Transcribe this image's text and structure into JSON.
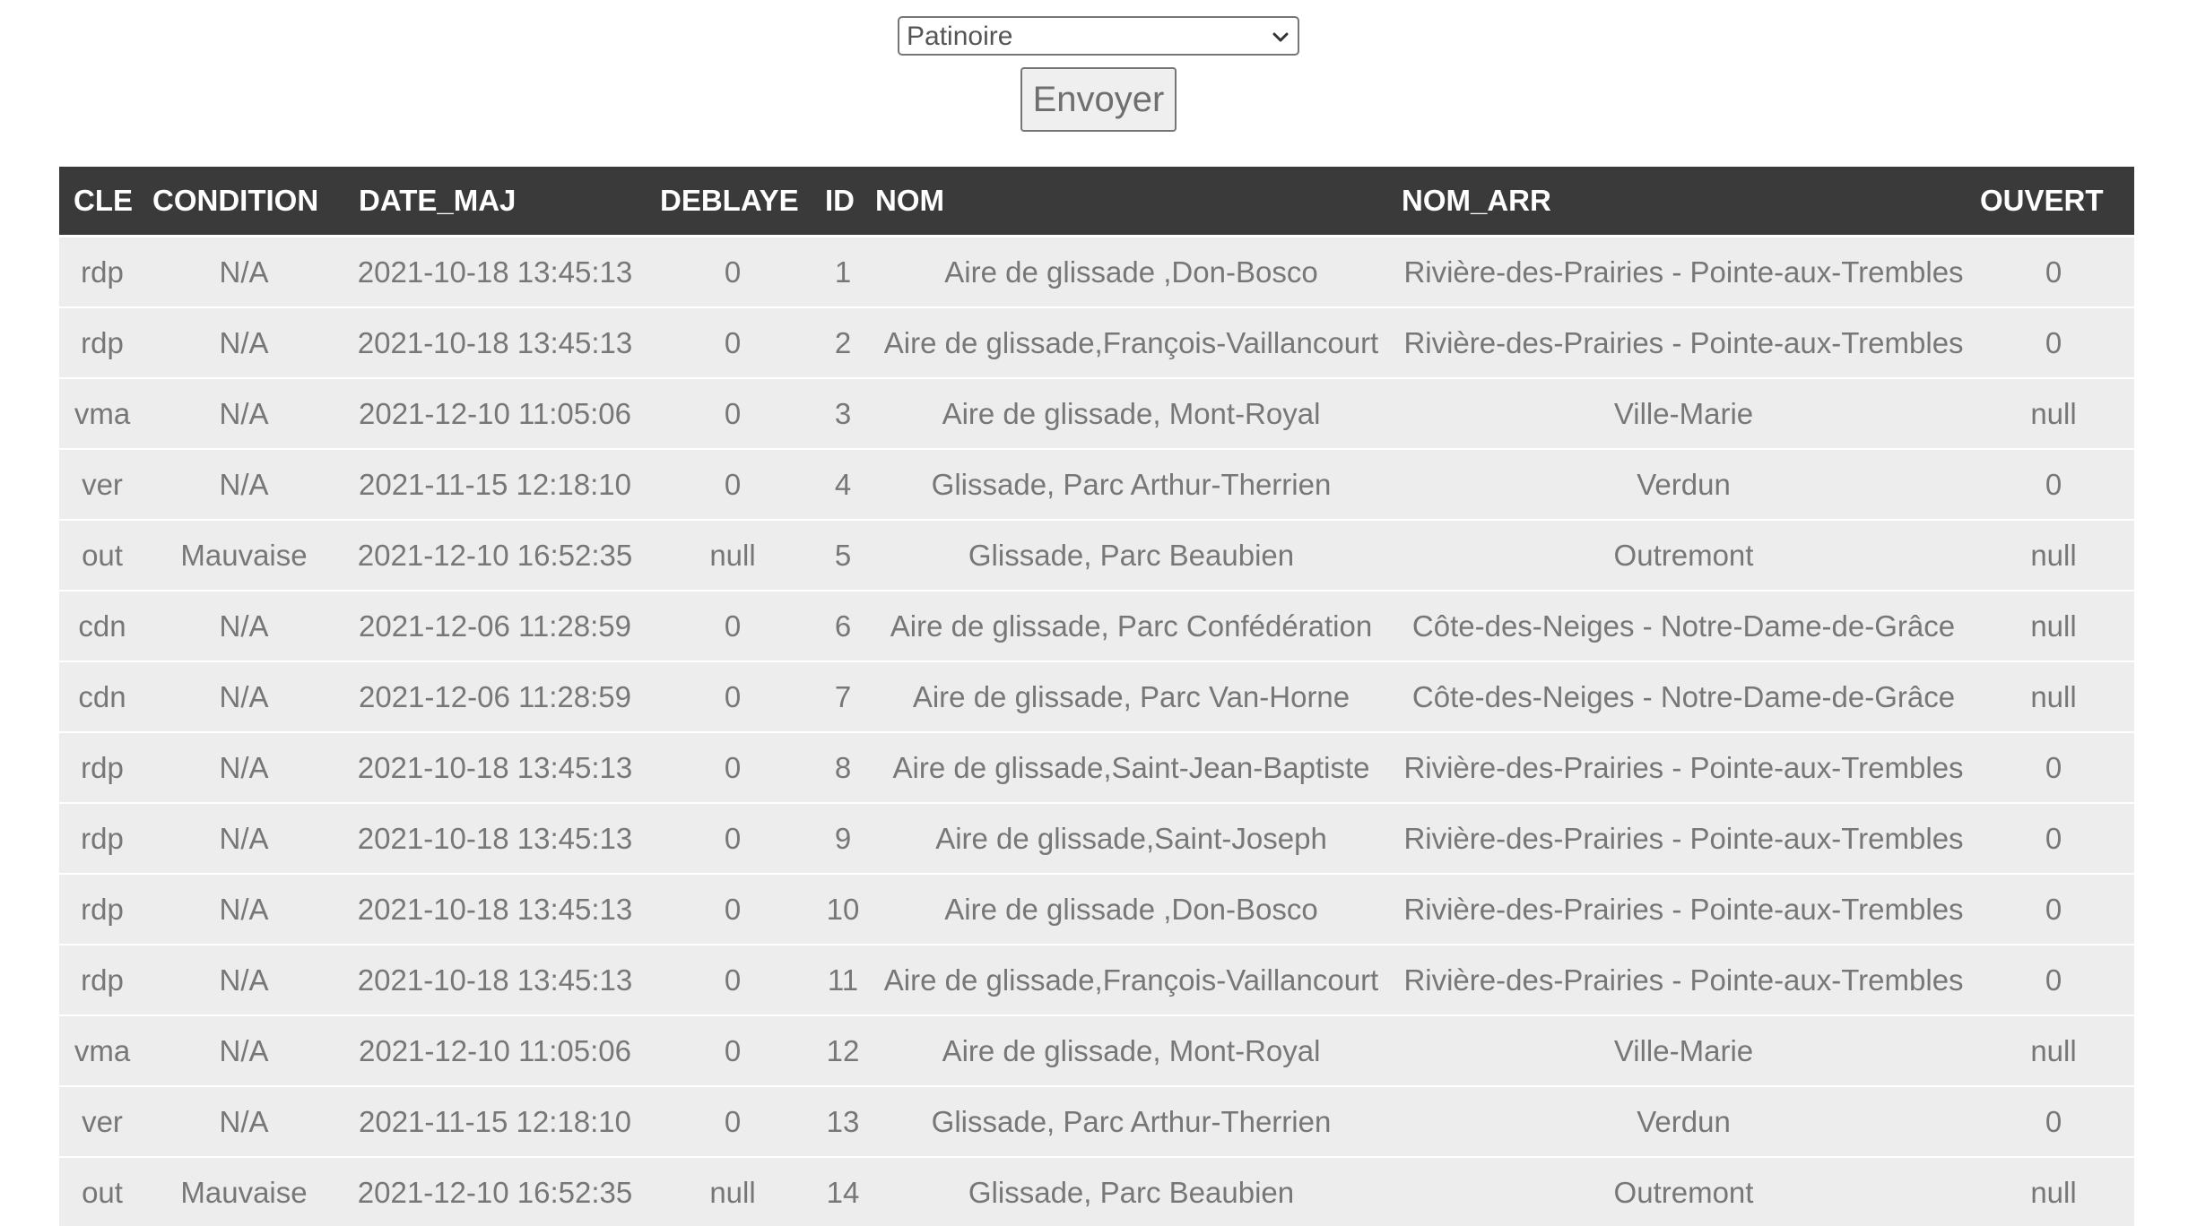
{
  "form": {
    "select_value": "Patinoire",
    "submit_label": "Envoyer"
  },
  "table": {
    "columns": [
      "CLE",
      "CONDITION",
      "DATE_MAJ",
      "DEBLAYE",
      "ID",
      "NOM",
      "NOM_ARR",
      "OUVERT"
    ],
    "rows": [
      [
        "rdp",
        "N/A",
        "2021-10-18 13:45:13",
        "0",
        "1",
        "Aire de glissade ,Don-Bosco",
        "Rivière-des-Prairies - Pointe-aux-Trembles",
        "0"
      ],
      [
        "rdp",
        "N/A",
        "2021-10-18 13:45:13",
        "0",
        "2",
        "Aire de glissade,François-Vaillancourt",
        "Rivière-des-Prairies - Pointe-aux-Trembles",
        "0"
      ],
      [
        "vma",
        "N/A",
        "2021-12-10 11:05:06",
        "0",
        "3",
        "Aire de glissade, Mont-Royal",
        "Ville-Marie",
        "null"
      ],
      [
        "ver",
        "N/A",
        "2021-11-15 12:18:10",
        "0",
        "4",
        "Glissade, Parc Arthur-Therrien",
        "Verdun",
        "0"
      ],
      [
        "out",
        "Mauvaise",
        "2021-12-10 16:52:35",
        "null",
        "5",
        "Glissade, Parc Beaubien",
        "Outremont",
        "null"
      ],
      [
        "cdn",
        "N/A",
        "2021-12-06 11:28:59",
        "0",
        "6",
        "Aire de glissade, Parc Confédération",
        "Côte-des-Neiges - Notre-Dame-de-Grâce",
        "null"
      ],
      [
        "cdn",
        "N/A",
        "2021-12-06 11:28:59",
        "0",
        "7",
        "Aire de glissade, Parc Van-Horne",
        "Côte-des-Neiges - Notre-Dame-de-Grâce",
        "null"
      ],
      [
        "rdp",
        "N/A",
        "2021-10-18 13:45:13",
        "0",
        "8",
        "Aire de glissade,Saint-Jean-Baptiste",
        "Rivière-des-Prairies - Pointe-aux-Trembles",
        "0"
      ],
      [
        "rdp",
        "N/A",
        "2021-10-18 13:45:13",
        "0",
        "9",
        "Aire de glissade,Saint-Joseph",
        "Rivière-des-Prairies - Pointe-aux-Trembles",
        "0"
      ],
      [
        "rdp",
        "N/A",
        "2021-10-18 13:45:13",
        "0",
        "10",
        "Aire de glissade ,Don-Bosco",
        "Rivière-des-Prairies - Pointe-aux-Trembles",
        "0"
      ],
      [
        "rdp",
        "N/A",
        "2021-10-18 13:45:13",
        "0",
        "11",
        "Aire de glissade,François-Vaillancourt",
        "Rivière-des-Prairies - Pointe-aux-Trembles",
        "0"
      ],
      [
        "vma",
        "N/A",
        "2021-12-10 11:05:06",
        "0",
        "12",
        "Aire de glissade, Mont-Royal",
        "Ville-Marie",
        "null"
      ],
      [
        "ver",
        "N/A",
        "2021-11-15 12:18:10",
        "0",
        "13",
        "Glissade, Parc Arthur-Therrien",
        "Verdun",
        "0"
      ],
      [
        "out",
        "Mauvaise",
        "2021-12-10 16:52:35",
        "null",
        "14",
        "Glissade, Parc Beaubien",
        "Outremont",
        "null"
      ]
    ]
  }
}
